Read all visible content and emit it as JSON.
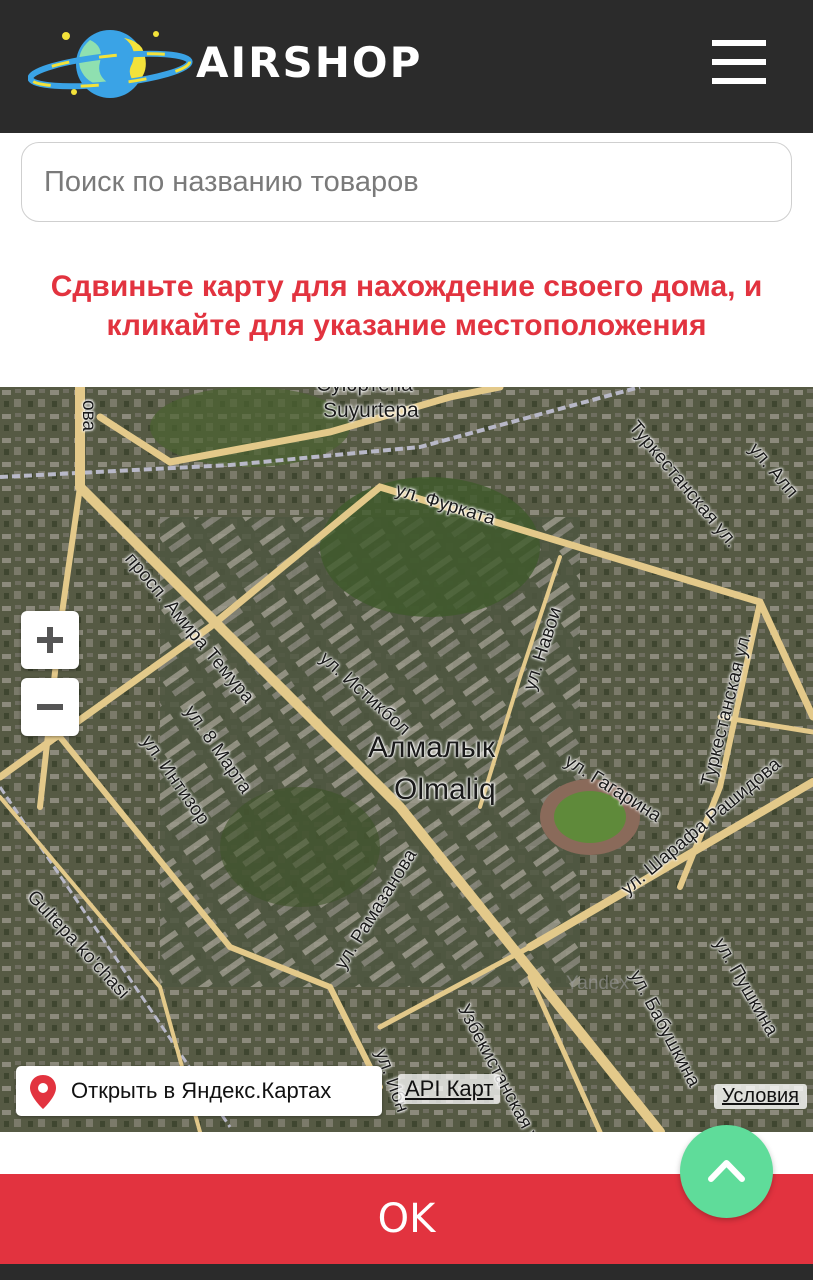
{
  "header": {
    "brand": "AIRSHOP",
    "logo_icon": "planet-logo",
    "menu_icon": "hamburger-menu-icon",
    "background_color": "#2b2b2b"
  },
  "search": {
    "placeholder": "Поиск по названию товаров",
    "value": ""
  },
  "instruction": {
    "line1": "Сдвиньте карту для нахождение своего дома, и",
    "line2": "кликайте для указание местоположения",
    "color": "#e2333f"
  },
  "map": {
    "labels": {
      "suyurtepa_cyr": "Суюртепа",
      "suyurtepa_lat": "Suyurtepa",
      "furkata": "ул. Фурката",
      "turkestan1": "Туркестанская ул.",
      "ulalp": "ул. Алп",
      "amir": "просп. Амира Темура",
      "navoi": "ул. Навои",
      "istiqbol": "ул. Истикбол",
      "turkestan2": "Туркестанская ул.",
      "march8": "ул. 8 Марта",
      "intizor": "ул. Интизор",
      "gagarina": "ул. Гагарина",
      "sharafa": "ул. Шарафа Рашидова",
      "ramazanova": "ул. Рамазанова",
      "gultepa": "Gultepa ko'chasi",
      "pushkina": "ул. Пушкина",
      "babushkina": "ул. Бабушкина",
      "uzbek": "Узбекистанская ул.",
      "ulbottom": "ул. Ибн",
      "ova": "ова",
      "city_cyr": "Алмалык",
      "city_lat": "Olmaliq",
      "watermark": "Yandex"
    },
    "zoom_in": "+",
    "zoom_out": "−",
    "open_in_yandex": "Открыть в Яндекс.Картах",
    "api_link": "API Карт",
    "terms_link": "Условия"
  },
  "ok_button": {
    "label": "OK",
    "color": "#e2333f"
  },
  "scroll_top_button": {
    "icon": "chevron-up-icon",
    "color": "#5fdc9a"
  }
}
